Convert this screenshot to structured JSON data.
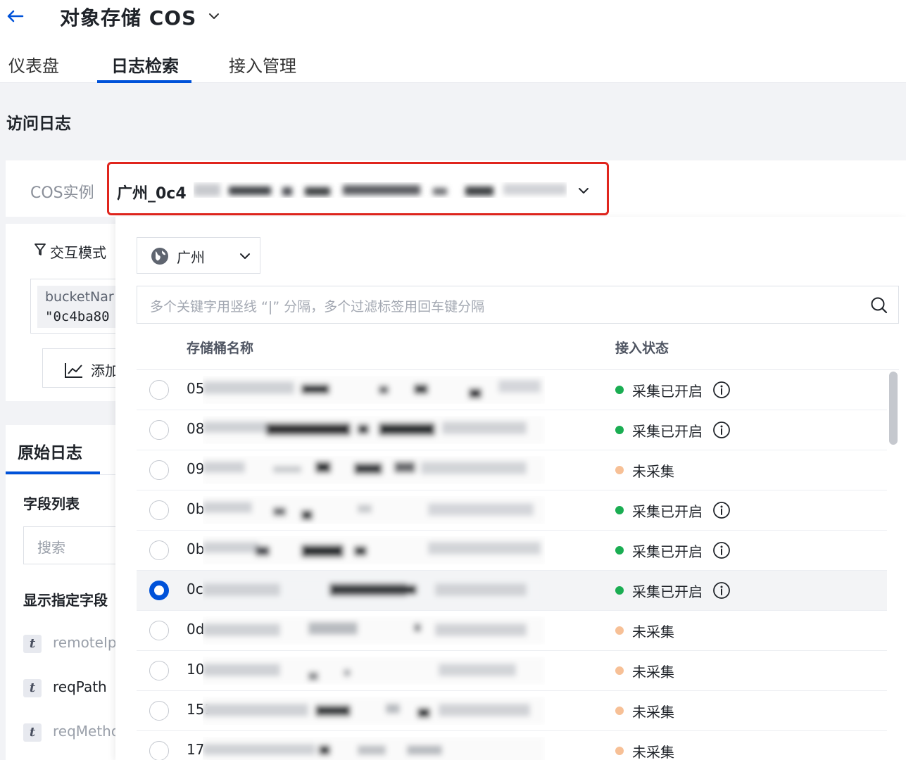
{
  "header": {
    "title": "对象存储 COS",
    "tabs": [
      {
        "label": "仪表盘",
        "active": false
      },
      {
        "label": "日志检索",
        "active": true
      },
      {
        "label": "接入管理",
        "active": false
      }
    ]
  },
  "section_title": "访问日志",
  "instance": {
    "label": "COS实例",
    "value": "广州_0c4"
  },
  "query_panel": {
    "mode_label": "交互模式",
    "filter_chip": {
      "line1": "bucketNar",
      "line2": "\"0c4ba80"
    },
    "add_button_label": "添加"
  },
  "raw_log": {
    "title": "原始日志",
    "field_list_title": "字段列表",
    "search_placeholder": "搜索",
    "show_fields_title": "显示指定字段",
    "fields": [
      {
        "type": "t",
        "name": "remoteIp",
        "active": false
      },
      {
        "type": "t",
        "name": "reqPath",
        "active": true
      },
      {
        "type": "t",
        "name": "reqMetho",
        "active": false
      }
    ]
  },
  "dropdown": {
    "region": "广州",
    "search_placeholder": "多个关键字用竖线 “|” 分隔，多个过滤标签用回车键分隔",
    "columns": {
      "name": "存储桶名称",
      "status": "接入状态"
    },
    "rows": [
      {
        "prefix": "05",
        "status": "采集已开启",
        "collecting": true,
        "selected": false
      },
      {
        "prefix": "08",
        "status": "采集已开启",
        "collecting": true,
        "selected": false
      },
      {
        "prefix": "09",
        "status": "未采集",
        "collecting": false,
        "selected": false
      },
      {
        "prefix": "0b",
        "status": "采集已开启",
        "collecting": true,
        "selected": false
      },
      {
        "prefix": "0b",
        "status": "采集已开启",
        "collecting": true,
        "selected": false
      },
      {
        "prefix": "0c",
        "status": "采集已开启",
        "collecting": true,
        "selected": true
      },
      {
        "prefix": "0d",
        "status": "未采集",
        "collecting": false,
        "selected": false
      },
      {
        "prefix": "10",
        "status": "未采集",
        "collecting": false,
        "selected": false
      },
      {
        "prefix": "151",
        "status": "未采集",
        "collecting": false,
        "selected": false
      },
      {
        "prefix": "17",
        "status": "未采集",
        "collecting": false,
        "selected": false
      }
    ]
  },
  "colors": {
    "accent": "#0052d9",
    "highlight_border": "#e0251d",
    "status_on": "#1aad52",
    "status_off": "#f7c096"
  }
}
